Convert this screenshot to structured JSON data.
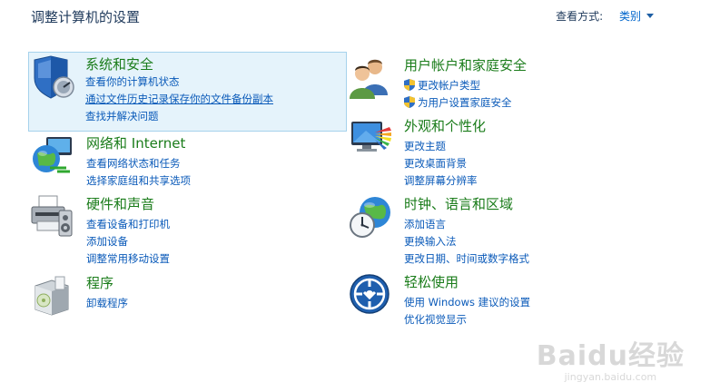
{
  "header": {
    "title": "调整计算机的设置",
    "view_by_label": "查看方式:",
    "view_by_value": "类别"
  },
  "categories": [
    {
      "title": "系统和安全",
      "icon": "shield-computer-icon",
      "links": [
        "查看你的计算机状态",
        "通过文件历史记录保存你的文件备份副本",
        "查找并解决问题"
      ]
    },
    {
      "title": "网络和 Internet",
      "icon": "network-globe-icon",
      "links": [
        "查看网络状态和任务",
        "选择家庭组和共享选项"
      ]
    },
    {
      "title": "硬件和声音",
      "icon": "printer-speaker-icon",
      "links": [
        "查看设备和打印机",
        "添加设备",
        "调整常用移动设置"
      ]
    },
    {
      "title": "程序",
      "icon": "programs-box-icon",
      "links": [
        "卸载程序"
      ]
    },
    {
      "title": "用户帐户和家庭安全",
      "icon": "users-icon",
      "links": [
        "更改帐户类型",
        "为用户设置家庭安全"
      ]
    },
    {
      "title": "外观和个性化",
      "icon": "monitor-palette-icon",
      "links": [
        "更改主题",
        "更改桌面背景",
        "调整屏幕分辨率"
      ]
    },
    {
      "title": "时钟、语言和区域",
      "icon": "clock-globe-icon",
      "links": [
        "添加语言",
        "更换输入法",
        "更改日期、时间或数字格式"
      ]
    },
    {
      "title": "轻松使用",
      "icon": "ease-of-access-icon",
      "links": [
        "使用 Windows 建议的设置",
        "优化视觉显示"
      ]
    }
  ],
  "watermark": {
    "line1": "Baidu经验",
    "line2": "jingyan.baidu.com"
  },
  "colors": {
    "title_green": "#1a7c1a",
    "link_blue": "#0a5ab9",
    "highlight_bg": "#e5f3fb",
    "highlight_border": "#a6d2ec"
  }
}
